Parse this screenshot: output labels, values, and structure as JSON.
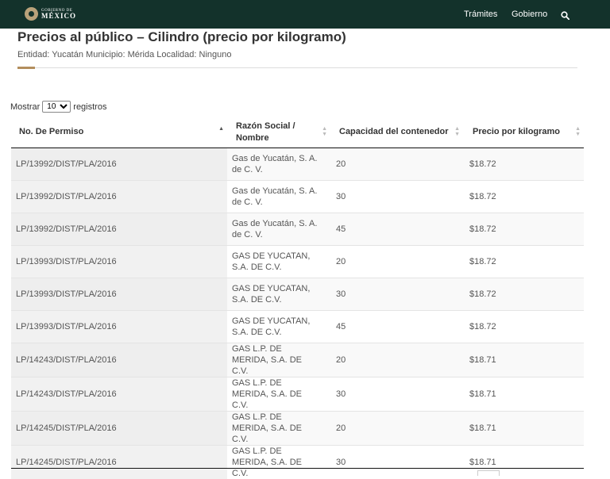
{
  "header": {
    "logo_top": "GOBIERNO DE",
    "logo_bottom": "MÉXICO",
    "nav": [
      "Trámites",
      "Gobierno"
    ],
    "search_icon": "search-icon"
  },
  "page": {
    "title": "Precios al público – Cilindro (precio por kilogramo)",
    "subtitle": "Entidad: Yucatán Municipio: Mérida Localidad: Ninguno"
  },
  "length": {
    "prefix": "Mostrar",
    "value": "10",
    "suffix": "registros"
  },
  "table": {
    "headers": [
      "No. De Permiso",
      "Razón Social / Nombre",
      "Capacidad del contenedor",
      "Precio por kilogramo"
    ],
    "rows": [
      [
        "LP/13992/DIST/PLA/2016",
        "Gas de Yucatán, S. A. de C. V.",
        "20",
        "$18.72"
      ],
      [
        "LP/13992/DIST/PLA/2016",
        "Gas de Yucatán, S. A. de C. V.",
        "30",
        "$18.72"
      ],
      [
        "LP/13992/DIST/PLA/2016",
        "Gas de Yucatán, S. A. de C. V.",
        "45",
        "$18.72"
      ],
      [
        "LP/13993/DIST/PLA/2016",
        "GAS DE YUCATAN, S.A. DE C.V.",
        "20",
        "$18.72"
      ],
      [
        "LP/13993/DIST/PLA/2016",
        "GAS DE YUCATAN, S.A. DE C.V.",
        "30",
        "$18.72"
      ],
      [
        "LP/13993/DIST/PLA/2016",
        "GAS DE YUCATAN, S.A. DE C.V.",
        "45",
        "$18.72"
      ],
      [
        "LP/14243/DIST/PLA/2016",
        "GAS L.P. DE MERIDA, S.A. DE C.V.",
        "20",
        "$18.71"
      ],
      [
        "LP/14243/DIST/PLA/2016",
        "GAS L.P. DE MERIDA, S.A. DE C.V.",
        "30",
        "$18.71"
      ],
      [
        "LP/14245/DIST/PLA/2016",
        "GAS L.P. DE MERIDA, S.A. DE C.V.",
        "20",
        "$18.71"
      ],
      [
        "LP/14245/DIST/PLA/2016",
        "GAS L.P. DE MERIDA, S.A. DE C.V.",
        "30",
        "$18.71"
      ]
    ]
  },
  "colors": {
    "header_bg": "#13322b",
    "accent": "#b38e5d"
  }
}
